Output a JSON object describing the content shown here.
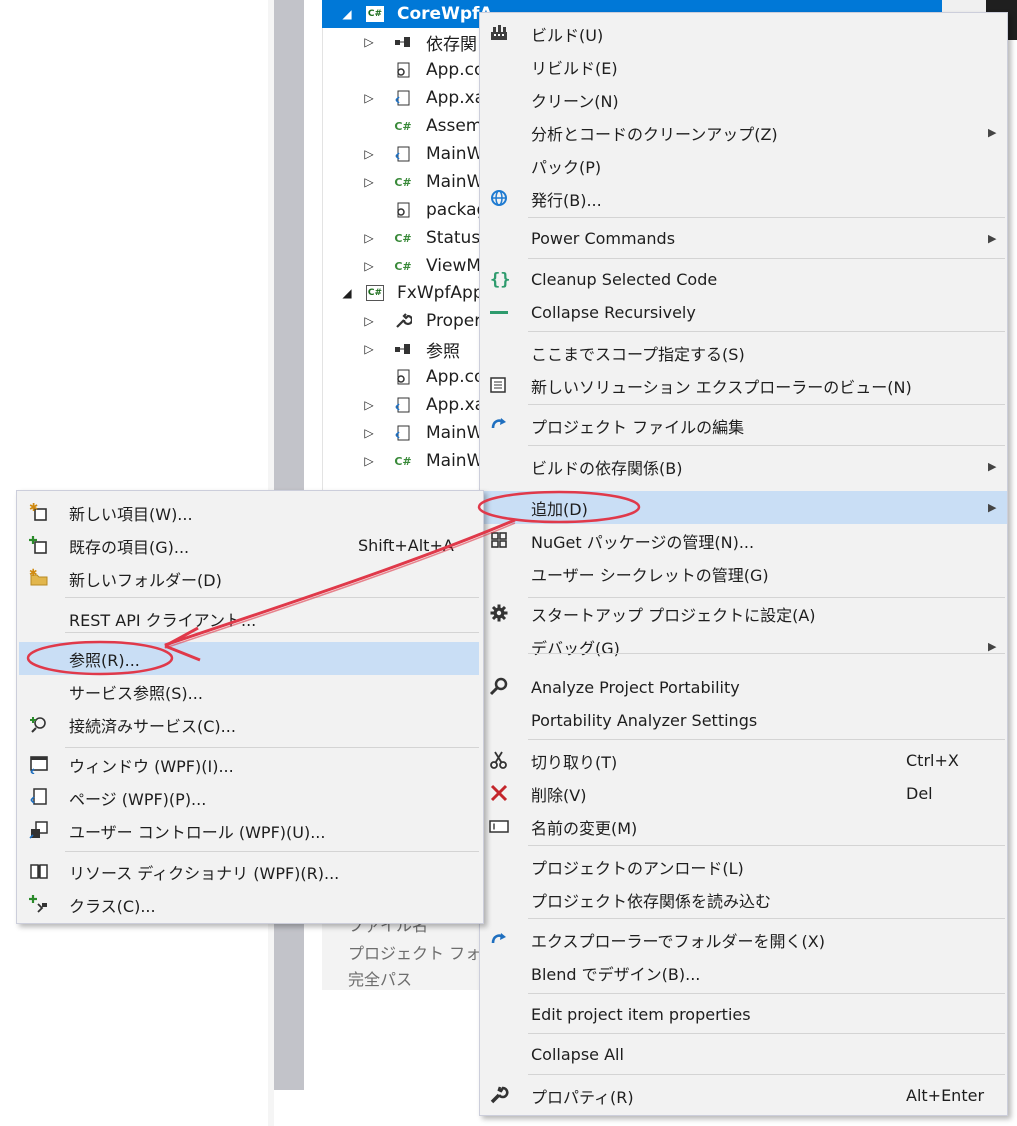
{
  "tree": {
    "rows": [
      {
        "label": "CoreWpfA",
        "arrow": "◢",
        "icon": "C#"
      },
      {
        "label": "依存関",
        "arrow": "▷",
        "icon": "deps"
      },
      {
        "label": "App.co",
        "arrow": "",
        "icon": "config"
      },
      {
        "label": "App.xa",
        "arrow": "▷",
        "icon": "xaml"
      },
      {
        "label": "Assem",
        "arrow": "",
        "icon": "C#"
      },
      {
        "label": "MainW",
        "arrow": "▷",
        "icon": "xaml"
      },
      {
        "label": "MainW",
        "arrow": "▷",
        "icon": "C#"
      },
      {
        "label": "packag",
        "arrow": "",
        "icon": "config"
      },
      {
        "label": "Status",
        "arrow": "▷",
        "icon": "C#"
      },
      {
        "label": "ViewM",
        "arrow": "▷",
        "icon": "C#"
      },
      {
        "label": "FxWpfApp",
        "arrow": "◢",
        "icon": "C#"
      },
      {
        "label": "Proper",
        "arrow": "▷",
        "icon": "wrench"
      },
      {
        "label": "参照",
        "arrow": "▷",
        "icon": "deps"
      },
      {
        "label": "App.co",
        "arrow": "",
        "icon": "config"
      },
      {
        "label": "App.xa",
        "arrow": "▷",
        "icon": "xaml"
      },
      {
        "label": "MainW",
        "arrow": "▷",
        "icon": "xaml"
      },
      {
        "label": "MainW",
        "arrow": "▷",
        "icon": "C#"
      }
    ],
    "cs_badge": "C#"
  },
  "properties": {
    "rows": [
      "ファイル名",
      "プロジェクト フォルダ",
      "完全パス"
    ]
  },
  "context_menu": {
    "items": [
      {
        "label": "ビルド(U)",
        "shortcut": "",
        "icon": "build-icon"
      },
      {
        "label": "リビルド(E)",
        "shortcut": ""
      },
      {
        "label": "クリーン(N)",
        "shortcut": ""
      },
      {
        "label": "分析とコードのクリーンアップ(Z)",
        "shortcut": "",
        "submenu": true
      },
      {
        "label": "パック(P)",
        "shortcut": ""
      },
      {
        "label": "発行(B)...",
        "shortcut": "",
        "icon": "publish-globe-icon"
      },
      {
        "label": "Power Commands",
        "shortcut": "",
        "submenu": true
      },
      {
        "label": "Cleanup Selected Code",
        "shortcut": "",
        "icon": "braces-icon"
      },
      {
        "label": "Collapse Recursively",
        "shortcut": "",
        "icon": "collapse-dash-icon"
      },
      {
        "label": "ここまでスコープ指定する(S)",
        "shortcut": ""
      },
      {
        "label": "新しいソリューション エクスプローラーのビュー(N)",
        "shortcut": "",
        "icon": "new-view-icon"
      },
      {
        "label": "プロジェクト ファイルの編集",
        "shortcut": "",
        "icon": "edit-project-icon"
      },
      {
        "label": "ビルドの依存関係(B)",
        "shortcut": "",
        "submenu": true
      },
      {
        "label": "追加(D)",
        "shortcut": "",
        "submenu": true,
        "highlight": true
      },
      {
        "label": "NuGet パッケージの管理(N)...",
        "shortcut": "",
        "icon": "nuget-icon"
      },
      {
        "label": "ユーザー シークレットの管理(G)",
        "shortcut": ""
      },
      {
        "label": "スタートアップ プロジェクトに設定(A)",
        "shortcut": "",
        "icon": "gear-icon"
      },
      {
        "label": "デバッグ(G)",
        "shortcut": "",
        "submenu": true
      },
      {
        "label": "Analyze Project Portability",
        "shortcut": "",
        "icon": "magnifier-icon"
      },
      {
        "label": "Portability Analyzer Settings",
        "shortcut": ""
      },
      {
        "label": "切り取り(T)",
        "shortcut": "Ctrl+X",
        "icon": "scissors-icon"
      },
      {
        "label": "削除(V)",
        "shortcut": "Del",
        "icon": "delete-x-icon"
      },
      {
        "label": "名前の変更(M)",
        "shortcut": "",
        "icon": "rename-icon"
      },
      {
        "label": "プロジェクトのアンロード(L)",
        "shortcut": ""
      },
      {
        "label": "プロジェクト依存関係を読み込む",
        "shortcut": ""
      },
      {
        "label": "エクスプローラーでフォルダーを開く(X)",
        "shortcut": "",
        "icon": "open-folder-arrow-icon"
      },
      {
        "label": "Blend でデザイン(B)...",
        "shortcut": ""
      },
      {
        "label": "Edit project item properties",
        "shortcut": ""
      },
      {
        "label": "Collapse All",
        "shortcut": ""
      },
      {
        "label": "プロパティ(R)",
        "shortcut": "Alt+Enter",
        "icon": "wrench-icon"
      }
    ]
  },
  "submenu": {
    "items": [
      {
        "label": "新しい項目(W)...",
        "shortcut": "",
        "icon": "new-item-icon"
      },
      {
        "label": "既存の項目(G)...",
        "shortcut": "Shift+Alt+A",
        "icon": "existing-item-icon"
      },
      {
        "label": "新しいフォルダー(D)",
        "shortcut": "",
        "icon": "new-folder-icon"
      },
      {
        "label": "REST API クライアント...",
        "shortcut": ""
      },
      {
        "label": "参照(R)...",
        "shortcut": "",
        "highlight": true
      },
      {
        "label": "サービス参照(S)...",
        "shortcut": ""
      },
      {
        "label": "接続済みサービス(C)...",
        "shortcut": "",
        "icon": "connected-service-icon"
      },
      {
        "label": "ウィンドウ (WPF)(I)...",
        "shortcut": "",
        "icon": "window-icon"
      },
      {
        "label": "ページ (WPF)(P)...",
        "shortcut": "",
        "icon": "page-icon"
      },
      {
        "label": "ユーザー コントロール (WPF)(U)...",
        "shortcut": "",
        "icon": "user-control-icon"
      },
      {
        "label": "リソース ディクショナリ (WPF)(R)...",
        "shortcut": "",
        "icon": "resource-dict-icon"
      },
      {
        "label": "クラス(C)...",
        "shortcut": "",
        "icon": "class-icon"
      }
    ]
  },
  "colors": {
    "selection": "#0078d7",
    "menu_bg": "#f2f2f2",
    "highlight": "#c9def5",
    "annotation": "#e0394a"
  }
}
